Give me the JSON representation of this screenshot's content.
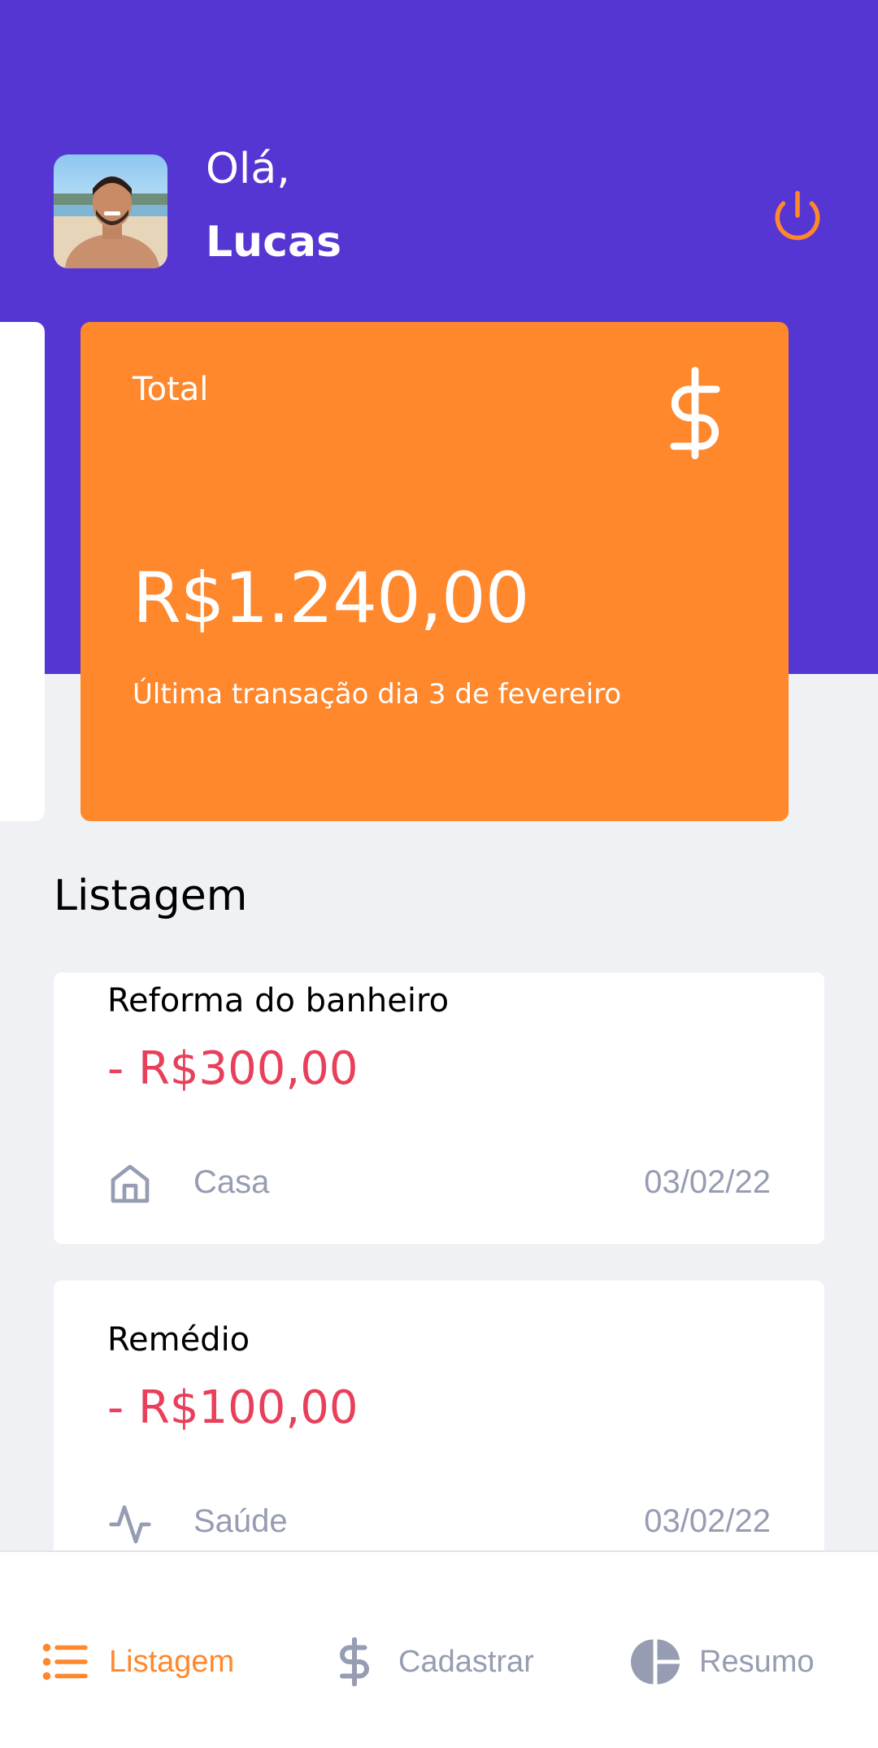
{
  "header": {
    "greeting": "Olá,",
    "username": "Lucas",
    "avatar_icon": "user-photo",
    "logout_icon": "power-icon",
    "logout_color": "#ff872c"
  },
  "total_card": {
    "title": "Total",
    "amount": "R$1.240,00",
    "subtitle": "Última transação dia 3 de fevereiro",
    "icon": "dollar-sign-icon",
    "background": "#ff872c"
  },
  "listing": {
    "title": "Listagem",
    "transactions": [
      {
        "name": "Reforma do banheiro",
        "amount": "- R$300,00",
        "category": "Casa",
        "category_icon": "home-icon",
        "date": "03/02/22"
      },
      {
        "name": "Remédio",
        "amount": "- R$100,00",
        "category": "Saúde",
        "category_icon": "activity-icon",
        "date": "03/02/22"
      }
    ]
  },
  "tabs": [
    {
      "label": "Listagem",
      "icon": "list-icon",
      "active": true
    },
    {
      "label": "Cadastrar",
      "icon": "dollar-sign-icon",
      "active": false
    },
    {
      "label": "Resumo",
      "icon": "pie-chart-icon",
      "active": false
    }
  ],
  "colors": {
    "primary": "#5636d3",
    "secondary": "#ff872c",
    "attention": "#e83f5b",
    "text_muted": "#969cb2",
    "background": "#f0f1f5"
  }
}
